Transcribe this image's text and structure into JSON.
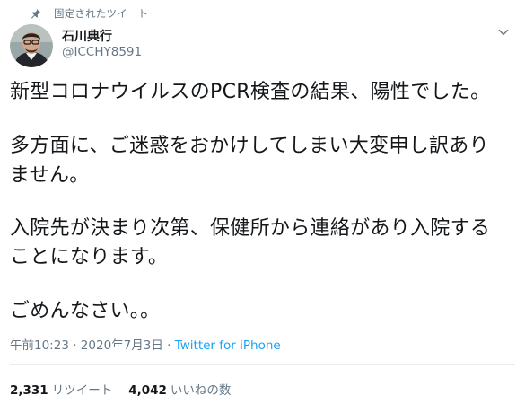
{
  "pinned": {
    "label": "固定されたツイート",
    "icon": "pin-icon"
  },
  "author": {
    "name": "石川典行",
    "handle": "@ICCHY8591",
    "avatar_icon": "avatar-photo"
  },
  "tweet": {
    "lines": [
      "新型コロナウイルスのPCR検査の結果、陽性でした。",
      "",
      "多方面に、ご迷惑をおかけしてしまい大変申し訳あり",
      "ません。",
      "",
      "入院先が決まり次第、保健所から連絡があり入院する",
      "ことになります。",
      "",
      "ごめんなさい。。"
    ]
  },
  "meta": {
    "time": "午前10:23",
    "separator": "·",
    "date": "2020年7月3日",
    "source": "Twitter for iPhone"
  },
  "stats": {
    "retweets_count": "2,331",
    "retweets_label": "リツイート",
    "likes_count": "4,042",
    "likes_label": "いいねの数"
  },
  "colors": {
    "accent": "#1da1f2",
    "secondary_text": "#657786",
    "primary_text": "#14171a",
    "divider": "#e6ecf0"
  }
}
